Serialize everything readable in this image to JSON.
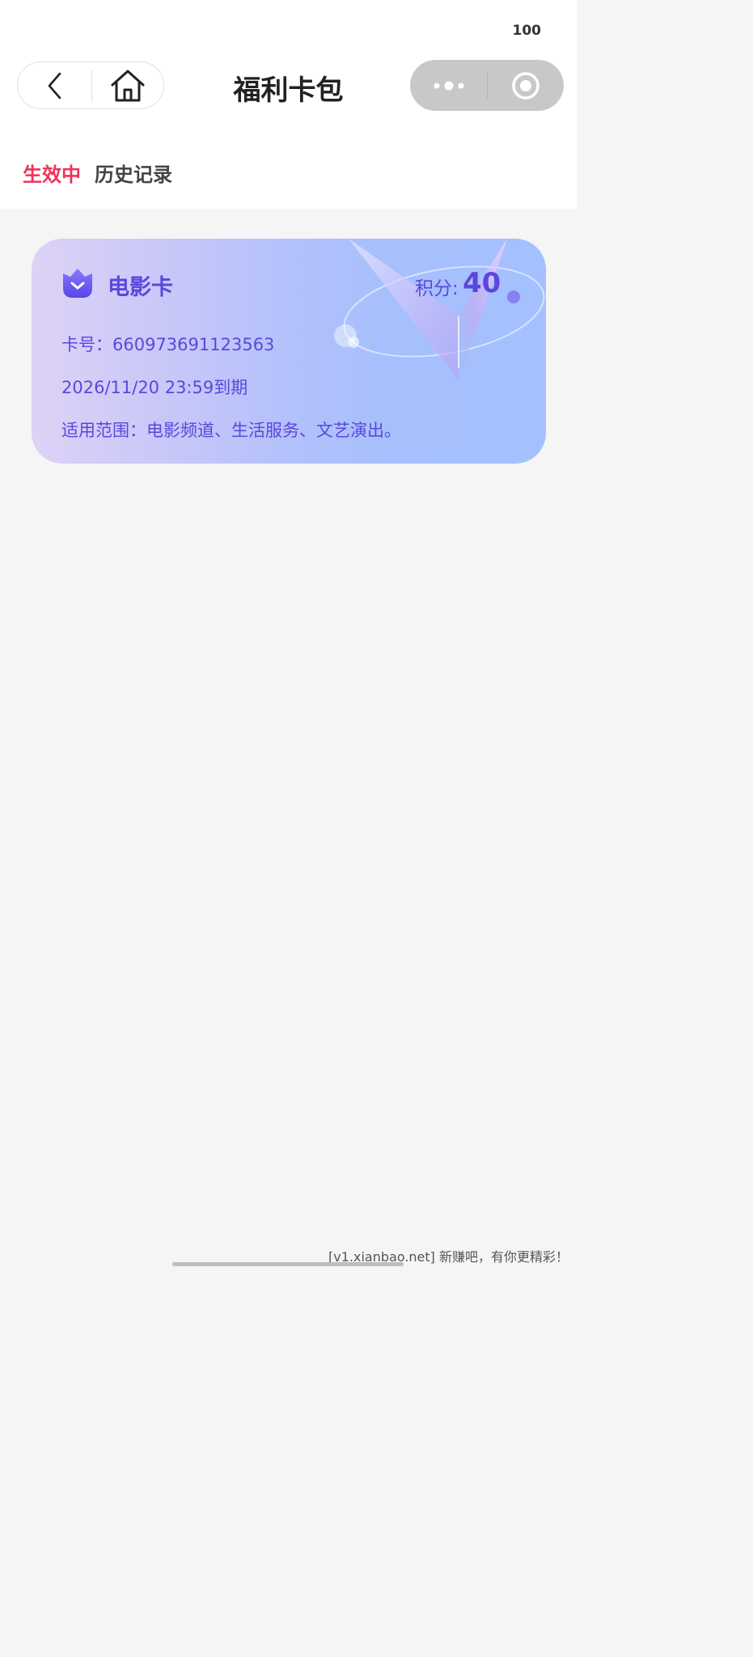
{
  "status_bar": {
    "battery": "100"
  },
  "header": {
    "title": "福利卡包",
    "back_icon": "chevron-left-icon",
    "home_icon": "home-icon",
    "more_icon": "more-dots-icon",
    "close_icon": "target-circle-icon"
  },
  "tabs": [
    {
      "label": "生效中",
      "active": true,
      "color": "#f0325a"
    },
    {
      "label": "历史记录",
      "active": false
    }
  ],
  "cards": [
    {
      "name": "电影卡",
      "icon": "shield-check-icon",
      "points_label": "积分:",
      "points_value": "40",
      "number_line": "卡号：660973691123563",
      "expire_line": "2026/11/20 23:59到期",
      "scope_line": "适用范围：电影频道、生活服务、文艺演出。",
      "accent_color": "#5b47dc"
    }
  ],
  "watermark": "[v1.xianbao.net] 新赚吧，有你更精彩！"
}
